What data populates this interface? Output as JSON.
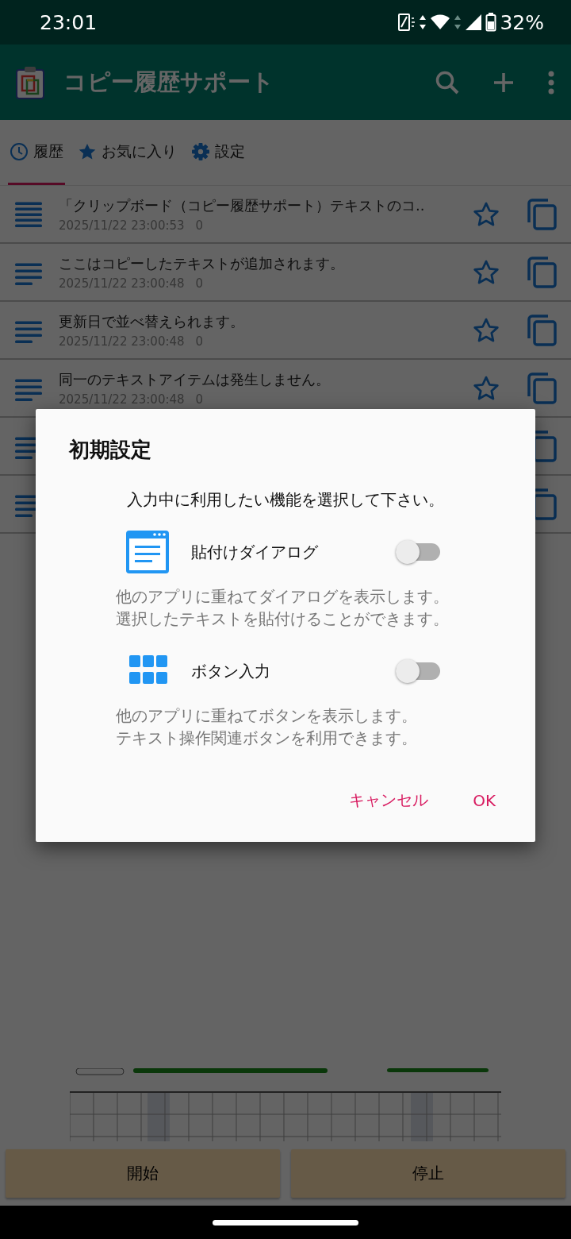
{
  "status_bar": {
    "time": "23:01",
    "battery": "32%"
  },
  "app_bar": {
    "title": "コピー履歴サポート"
  },
  "tabs": [
    {
      "label": "履歴",
      "selected": true
    },
    {
      "label": "お気に入り",
      "selected": false
    },
    {
      "label": "設定",
      "selected": false
    }
  ],
  "list_rows": [
    {
      "kind": "item",
      "title": "「クリップボード（コピー履歴サポート）テキストのコ..",
      "date": "2025/11/22 23:00:53",
      "count": "0",
      "favorite": false
    },
    {
      "kind": "item",
      "title": "ここはコピーしたテキストが追加されます。",
      "date": "2025/11/22 23:00:48",
      "count": "0",
      "favorite": false
    },
    {
      "kind": "item",
      "title": "更新日で並べ替えられます。",
      "date": "2025/11/22 23:00:48",
      "count": "0",
      "favorite": false
    },
    {
      "kind": "item",
      "title": "同一のテキストアイテムは発生しません。",
      "date": "2025/11/22 23:00:48",
      "count": "0",
      "favorite": false
    },
    {
      "kind": "covered"
    },
    {
      "kind": "covered"
    }
  ],
  "ad_banner": {
    "kind": "picture"
  },
  "bottom_buttons": [
    "開始",
    "停止"
  ],
  "dialog": {
    "title": "初期設定",
    "message": "入力中に利用したい機能を選択して下さい。",
    "options": [
      {
        "label": "貼付けダイアログ",
        "on": false,
        "description": [
          "他のアプリに重ねてダイアログを表示します。",
          "選択したテキストを貼付けることができます。"
        ]
      },
      {
        "label": "ボタン入力",
        "on": false,
        "description": [
          "他のアプリに重ねてボタンを表示します。",
          "テキスト操作関連ボタンを利用できます。"
        ]
      }
    ],
    "buttons": [
      "キャンセル",
      "OK"
    ]
  }
}
